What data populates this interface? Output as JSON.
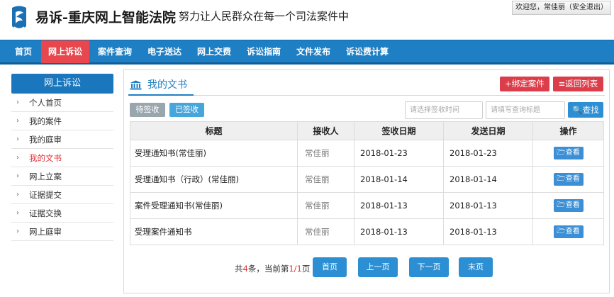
{
  "header": {
    "site_title": "易诉-重庆网上智能法院",
    "slogan": "努力让人民群众在每一个司法案件中",
    "welcome": "欢迎您，常佳丽（安全退出）"
  },
  "nav": {
    "items": [
      "首页",
      "网上诉讼",
      "案件查询",
      "电子送达",
      "网上交费",
      "诉讼指南",
      "文件发布",
      "诉讼费计算"
    ],
    "active_index": 1
  },
  "sidebar": {
    "title": "网上诉讼",
    "items": [
      "个人首页",
      "我的案件",
      "我的庭审",
      "我的文书",
      "网上立案",
      "证据提交",
      "证据交换",
      "网上庭审"
    ],
    "active_index": 3
  },
  "panel": {
    "title": "我的文书",
    "bind_case_label": "+绑定案件",
    "back_list_label": "≡返回列表",
    "filters": {
      "pending_label": "待签收",
      "signed_label": "已签收"
    },
    "date_placeholder": "请选择签收时间",
    "keyword_placeholder": "请填写查询标题",
    "search_label": "查找"
  },
  "table": {
    "headers": [
      "标题",
      "接收人",
      "签收日期",
      "发送日期",
      "操作"
    ],
    "rows": [
      {
        "title": "受理通知书(常佳丽)",
        "receiver": "常佳丽",
        "sign_date": "2018-01-23",
        "send_date": "2018-01-23",
        "action": "查看"
      },
      {
        "title": "受理通知书（行政）(常佳丽)",
        "receiver": "常佳丽",
        "sign_date": "2018-01-14",
        "send_date": "2018-01-14",
        "action": "查看"
      },
      {
        "title": "案件受理通知书(常佳丽)",
        "receiver": "常佳丽",
        "sign_date": "2018-01-13",
        "send_date": "2018-01-13",
        "action": "查看"
      },
      {
        "title": "受理案件通知书",
        "receiver": "常佳丽",
        "sign_date": "2018-01-13",
        "send_date": "2018-01-13",
        "action": "查看"
      }
    ]
  },
  "pager": {
    "total_prefix": "共",
    "total": "4",
    "total_mid": "条，当前第",
    "current": "1/1",
    "total_suffix": "页",
    "buttons": [
      "首页",
      "上一页",
      "下一页",
      "末页"
    ]
  },
  "colors": {
    "brand_blue": "#1f7fc4",
    "active_red": "#e8474d",
    "action_red": "#dc3d4a"
  }
}
